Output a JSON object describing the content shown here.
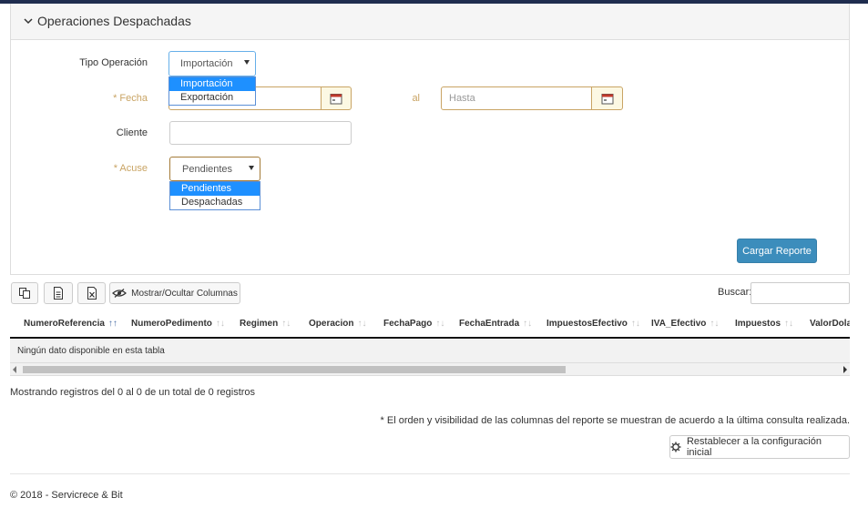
{
  "panel": {
    "title": "Operaciones Despachadas"
  },
  "form": {
    "tipo_label": "Tipo Operación",
    "tipo_value": "Importación",
    "tipo_options": [
      "Importación",
      "Exportación"
    ],
    "fecha_label": "* Fecha",
    "al_label": "al",
    "hasta_placeholder": "Hasta",
    "cliente_label": "Cliente",
    "acuse_label": "* Acuse",
    "acuse_value": "Pendientes",
    "acuse_options": [
      "Pendientes",
      "Despachadas"
    ],
    "cargar_button": "Cargar Reporte"
  },
  "toolbar": {
    "toggle_columns": "Mostrar/Ocultar Columnas",
    "search_label": "Buscar:"
  },
  "table": {
    "columns": [
      "NumeroReferencia",
      "NumeroPedimento",
      "Regimen",
      "Operacion",
      "FechaPago",
      "FechaEntrada",
      "ImpuestosEfectivo",
      "IVA_Efectivo",
      "Impuestos",
      "ValorDolar"
    ],
    "empty_message": "Ningún dato disponible en esta tabla",
    "info": "Mostrando registros del 0 al 0 de un total de 0 registros"
  },
  "note": "* El orden y visibilidad de las columnas del reporte se muestran de acuerdo a la última consulta realizada.",
  "reset_button": "Restablecer a la configuración inicial",
  "footer": "© 2018 - Servicrece & Bit",
  "colors": {
    "accent": "#3c8dbc",
    "required": "#c9a464",
    "topbar": "#1f2d4f"
  }
}
